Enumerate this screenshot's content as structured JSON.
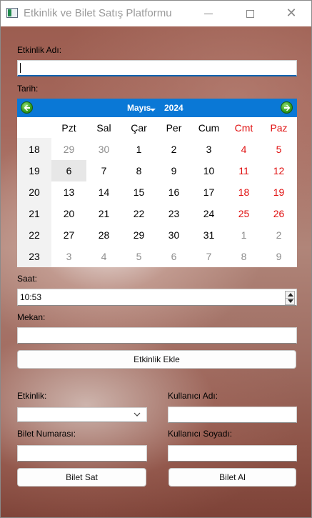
{
  "window": {
    "title": "Etkinlik ve Bilet Satış Platformu",
    "minimize": "—",
    "maximize": "☐",
    "close": "✕"
  },
  "form": {
    "event_name_label": "Etkinlik Adı:",
    "event_name_value": "",
    "date_label": "Tarih:",
    "time_label": "Saat:",
    "time_value": "10:53",
    "venue_label": "Mekan:",
    "venue_value": "",
    "add_event_button": "Etkinlik Ekle"
  },
  "calendar": {
    "month": "Mayıs",
    "year": "2024",
    "weekdays": [
      "Pzt",
      "Sal",
      "Çar",
      "Per",
      "Cum",
      "Cmt",
      "Paz"
    ],
    "weekend_color": "#e01010",
    "header_color": "#0a78d6",
    "weeks": [
      {
        "week": "18",
        "days": [
          "29",
          "30",
          "1",
          "2",
          "3",
          "4",
          "5"
        ],
        "outside": [
          true,
          true,
          false,
          false,
          false,
          false,
          false
        ]
      },
      {
        "week": "19",
        "days": [
          "6",
          "7",
          "8",
          "9",
          "10",
          "11",
          "12"
        ],
        "outside": [
          false,
          false,
          false,
          false,
          false,
          false,
          false
        ]
      },
      {
        "week": "20",
        "days": [
          "13",
          "14",
          "15",
          "16",
          "17",
          "18",
          "19"
        ],
        "outside": [
          false,
          false,
          false,
          false,
          false,
          false,
          false
        ]
      },
      {
        "week": "21",
        "days": [
          "20",
          "21",
          "22",
          "23",
          "24",
          "25",
          "26"
        ],
        "outside": [
          false,
          false,
          false,
          false,
          false,
          false,
          false
        ]
      },
      {
        "week": "22",
        "days": [
          "27",
          "28",
          "29",
          "30",
          "31",
          "1",
          "2"
        ],
        "outside": [
          false,
          false,
          false,
          false,
          false,
          true,
          true
        ]
      },
      {
        "week": "23",
        "days": [
          "3",
          "4",
          "5",
          "6",
          "7",
          "8",
          "9"
        ],
        "outside": [
          true,
          true,
          true,
          true,
          true,
          true,
          true
        ]
      }
    ],
    "selected_day": "6"
  },
  "sales": {
    "event_label": "Etkinlik:",
    "event_value": "",
    "ticket_number_label": "Bilet Numarası:",
    "ticket_number_value": "",
    "sell_button": "Bilet Sat",
    "username_label": "Kullanıcı Adı:",
    "username_value": "",
    "surname_label": "Kullanıcı Soyadı:",
    "surname_value": "",
    "buy_button": "Bilet Al"
  }
}
